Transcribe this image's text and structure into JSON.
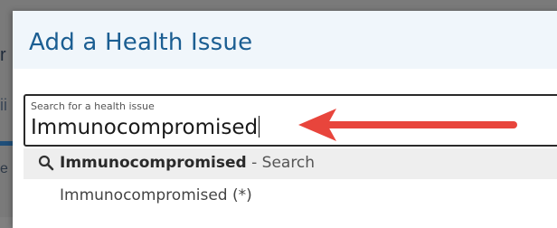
{
  "background": {
    "fragments": [
      "r",
      "ii",
      "e"
    ]
  },
  "modal": {
    "title": "Add a Health Issue"
  },
  "search": {
    "label": "Search for a health issue",
    "value": "Immunocompromised"
  },
  "results": {
    "search_item": {
      "term": "Immunocompromised",
      "suffix": "- Search",
      "icon": "search-icon"
    },
    "items": [
      {
        "label": "Immunocompromised (*)"
      }
    ]
  },
  "annotation": {
    "arrow_color": "#e8453c",
    "icon": "arrow-left-icon"
  },
  "colors": {
    "title": "#1b5e92",
    "header_bg": "#f0f6fb",
    "highlight_bg": "#eeeeee"
  }
}
